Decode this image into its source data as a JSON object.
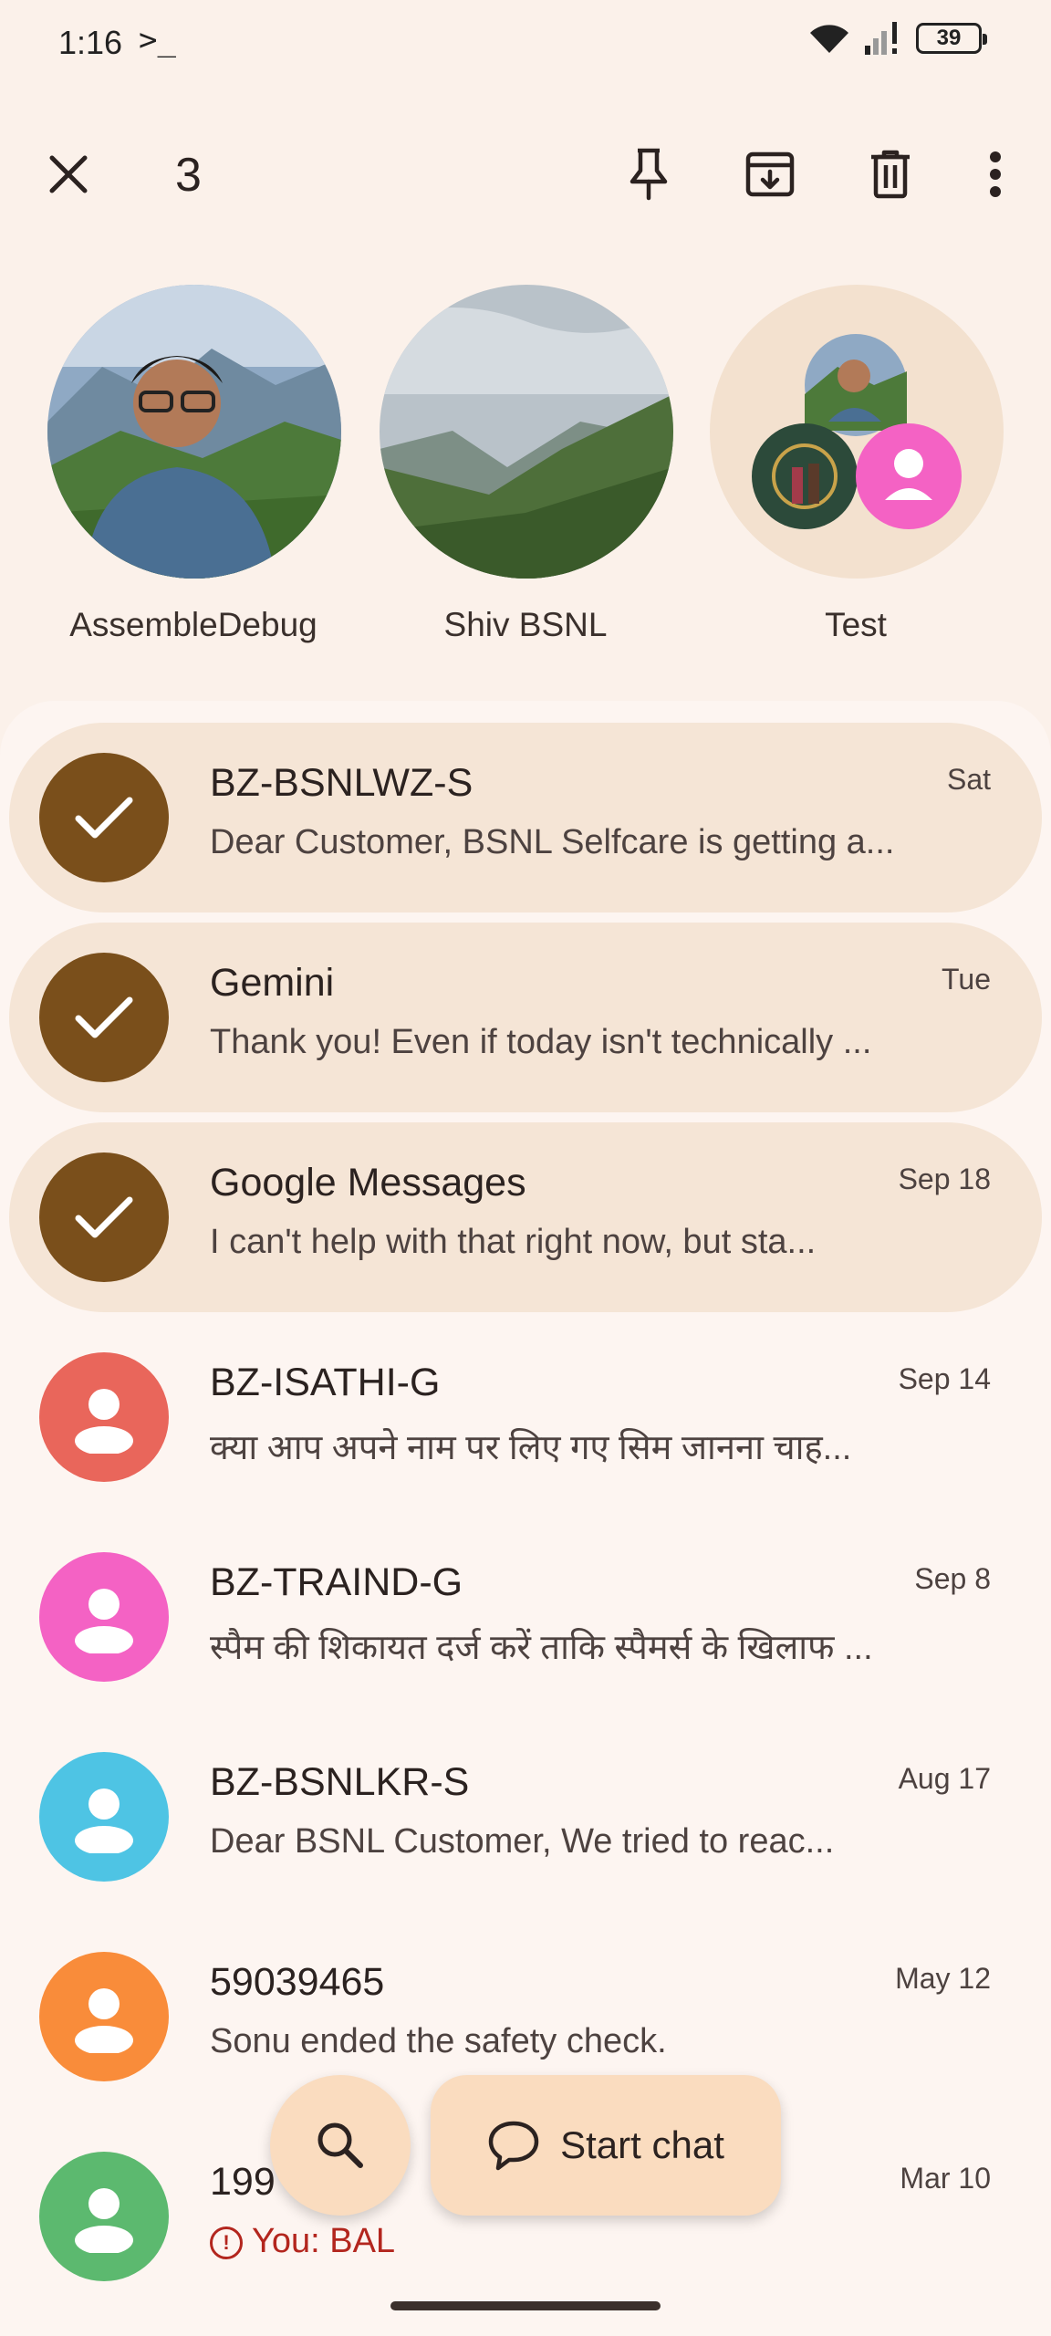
{
  "status_bar": {
    "time": "1:16",
    "terminal_glyph": ">_",
    "battery": "39"
  },
  "toolbar": {
    "selected_count": "3"
  },
  "pinned": [
    {
      "name": "AssembleDebug"
    },
    {
      "name": "Shiv BSNL"
    },
    {
      "name": "Test"
    }
  ],
  "conversations": [
    {
      "title": "BZ-BSNLWZ-S",
      "snippet": "Dear Customer, BSNL Selfcare is getting a...",
      "date": "Sat",
      "selected": true
    },
    {
      "title": "Gemini",
      "snippet": "Thank you! Even if today isn't technically ...",
      "date": "Tue",
      "selected": true
    },
    {
      "title": "Google Messages",
      "snippet": "I can't help with that right now, but sta...",
      "date": "Sep 18",
      "selected": true
    },
    {
      "title": "BZ-ISATHI-G",
      "snippet": "क्या आप अपने नाम पर लिए गए सिम जानना चाह...",
      "date": "Sep 14",
      "avatar_color": "#e9665b"
    },
    {
      "title": "BZ-TRAIND-G",
      "snippet": "स्पैम की शिकायत दर्ज करें ताकि स्पैमर्स के खिलाफ ...",
      "date": "Sep 8",
      "avatar_color": "#f462c4"
    },
    {
      "title": "BZ-BSNLKR-S",
      "snippet": "Dear BSNL Customer, We tried to reac...",
      "date": "Aug 17",
      "avatar_color": "#4ec4e4"
    },
    {
      "title": "59039465",
      "snippet": "Sonu ended the safety check.",
      "date": "May 12",
      "avatar_color": "#f98c3a"
    },
    {
      "title": "199",
      "snippet": "You: BAL",
      "date": "Mar 10",
      "avatar_color": "#5cb96f"
    }
  ],
  "fab": {
    "start_chat_label": "Start chat"
  },
  "colors": {
    "background": "#fbf1ea",
    "selected_row": "#f5e5d6",
    "check_avatar": "#7a4f1b",
    "fab": "#fadcbf",
    "error": "#b3261e"
  },
  "icons": {
    "toolbar": [
      "close-icon",
      "pin-icon",
      "archive-icon",
      "delete-icon",
      "more-vert-icon"
    ],
    "fab": [
      "search-icon",
      "chat-bubble-icon"
    ]
  }
}
